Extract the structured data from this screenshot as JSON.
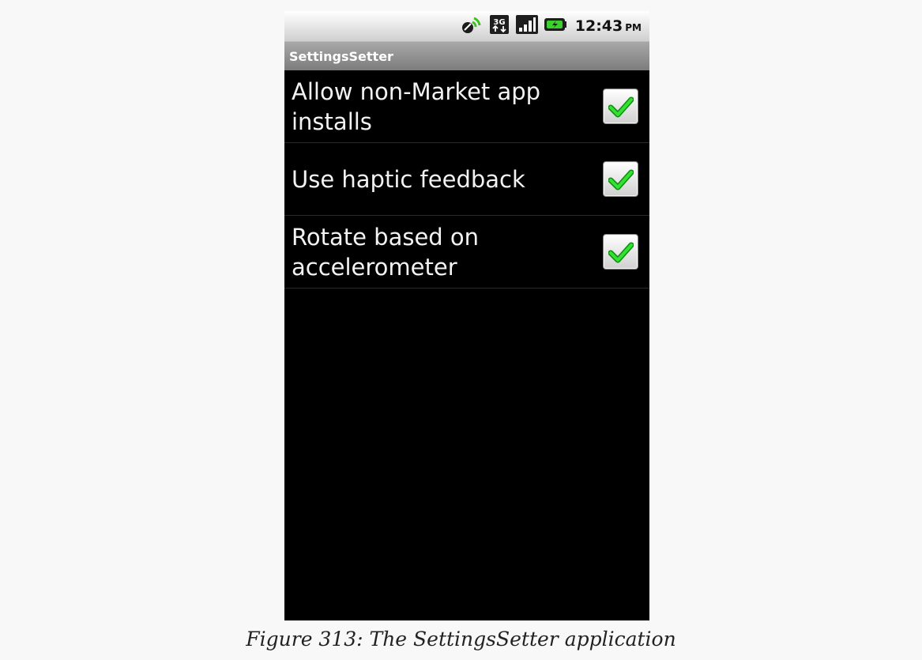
{
  "status_bar": {
    "time": "12:43",
    "ampm": "PM",
    "network_label": "3G",
    "icons": [
      "gps-icon",
      "3g-data-icon",
      "signal-strength-icon",
      "battery-charging-icon"
    ]
  },
  "app": {
    "title": "SettingsSetter"
  },
  "preferences": [
    {
      "label": "Allow non-Market app installs",
      "checked": true
    },
    {
      "label": "Use haptic feedback",
      "checked": true
    },
    {
      "label": "Rotate based on accelerometer",
      "checked": true
    }
  ],
  "caption": "Figure 313: The SettingsSetter application",
  "colors": {
    "checkmark": "#22cc22",
    "background": "#000000",
    "title_bar": "#8e8e8e"
  }
}
